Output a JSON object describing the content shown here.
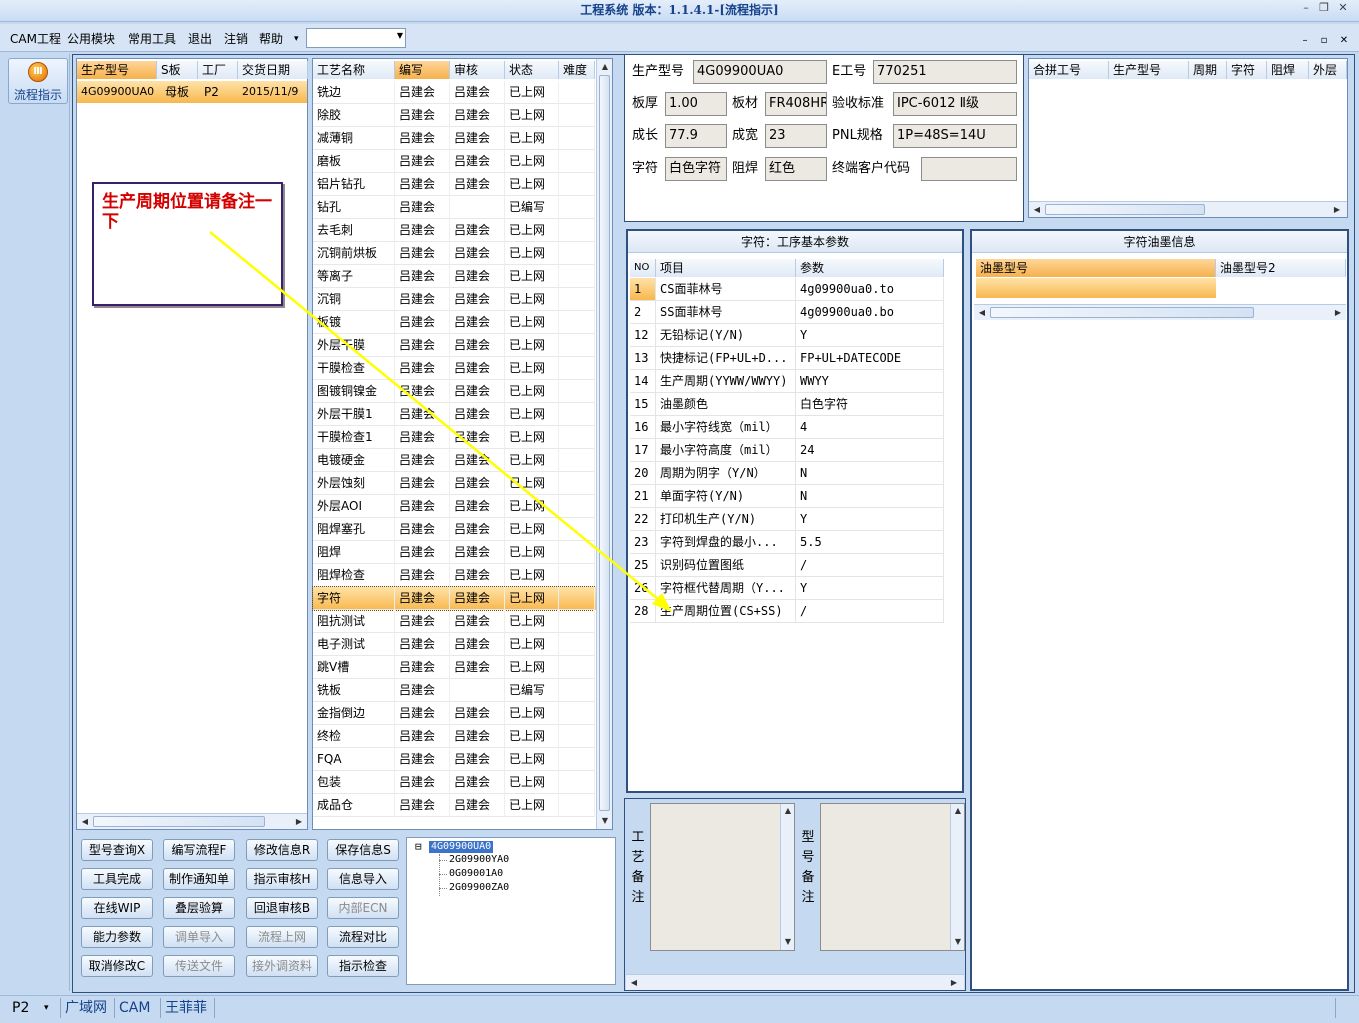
{
  "window": {
    "title": "工程系统 版本：1.1.4.1-[流程指示]",
    "min": "–",
    "max": "❐",
    "close": "✕"
  },
  "menu": {
    "items": [
      "CAM工程",
      "公用模块",
      "常用工具",
      "退出",
      "注销",
      "帮助"
    ],
    "help_arrow": "▾",
    "combo_value": "",
    "mdi": [
      "–",
      "▫",
      "✕"
    ]
  },
  "sidebar": {
    "button_label": "流程指示",
    "icon": "flow-icon"
  },
  "order_table": {
    "headers": [
      "生产型号",
      "S板",
      "工厂",
      "交货日期"
    ],
    "rows": [
      [
        "4G09900UA0",
        "母板",
        "P2",
        "2015/11/9"
      ]
    ]
  },
  "process_table": {
    "headers": [
      "工艺名称",
      "编写",
      "审核",
      "状态",
      "难度"
    ],
    "rows": [
      [
        "铣边",
        "吕建会",
        "吕建会",
        "已上网",
        ""
      ],
      [
        "除胶",
        "吕建会",
        "吕建会",
        "已上网",
        ""
      ],
      [
        "减薄铜",
        "吕建会",
        "吕建会",
        "已上网",
        ""
      ],
      [
        "磨板",
        "吕建会",
        "吕建会",
        "已上网",
        ""
      ],
      [
        "铝片钻孔",
        "吕建会",
        "吕建会",
        "已上网",
        ""
      ],
      [
        "钻孔",
        "吕建会",
        "",
        "已编写",
        ""
      ],
      [
        "去毛刺",
        "吕建会",
        "吕建会",
        "已上网",
        ""
      ],
      [
        "沉铜前烘板",
        "吕建会",
        "吕建会",
        "已上网",
        ""
      ],
      [
        "等离子",
        "吕建会",
        "吕建会",
        "已上网",
        ""
      ],
      [
        "沉铜",
        "吕建会",
        "吕建会",
        "已上网",
        ""
      ],
      [
        "板镀",
        "吕建会",
        "吕建会",
        "已上网",
        ""
      ],
      [
        "外层干膜",
        "吕建会",
        "吕建会",
        "已上网",
        ""
      ],
      [
        "干膜检查",
        "吕建会",
        "吕建会",
        "已上网",
        ""
      ],
      [
        "图镀铜镍金",
        "吕建会",
        "吕建会",
        "已上网",
        ""
      ],
      [
        "外层干膜1",
        "吕建会",
        "吕建会",
        "已上网",
        ""
      ],
      [
        "干膜检查1",
        "吕建会",
        "吕建会",
        "已上网",
        ""
      ],
      [
        "电镀硬金",
        "吕建会",
        "吕建会",
        "已上网",
        ""
      ],
      [
        "外层蚀刻",
        "吕建会",
        "吕建会",
        "已上网",
        ""
      ],
      [
        "外层AOI",
        "吕建会",
        "吕建会",
        "已上网",
        ""
      ],
      [
        "阻焊塞孔",
        "吕建会",
        "吕建会",
        "已上网",
        ""
      ],
      [
        "阻焊",
        "吕建会",
        "吕建会",
        "已上网",
        ""
      ],
      [
        "阻焊检查",
        "吕建会",
        "吕建会",
        "已上网",
        ""
      ],
      [
        "字符",
        "吕建会",
        "吕建会",
        "已上网",
        ""
      ],
      [
        "阻抗测试",
        "吕建会",
        "吕建会",
        "已上网",
        ""
      ],
      [
        "电子测试",
        "吕建会",
        "吕建会",
        "已上网",
        ""
      ],
      [
        "跳V槽",
        "吕建会",
        "吕建会",
        "已上网",
        ""
      ],
      [
        "铣板",
        "吕建会",
        "",
        "已编写",
        ""
      ],
      [
        "金指倒边",
        "吕建会",
        "吕建会",
        "已上网",
        ""
      ],
      [
        "终检",
        "吕建会",
        "吕建会",
        "已上网",
        ""
      ],
      [
        "FQA",
        "吕建会",
        "吕建会",
        "已上网",
        ""
      ],
      [
        "包装",
        "吕建会",
        "吕建会",
        "已上网",
        ""
      ],
      [
        "成品仓",
        "吕建会",
        "吕建会",
        "已上网",
        ""
      ]
    ],
    "selected_index": 22
  },
  "annotation": {
    "text": "生产周期位置请备注一下"
  },
  "buttons": {
    "rows": [
      [
        {
          "label": "型号查询X",
          "enabled": true
        },
        {
          "label": "编写流程F",
          "enabled": true
        },
        {
          "label": "修改信息R",
          "enabled": true
        },
        {
          "label": "保存信息S",
          "enabled": true
        }
      ],
      [
        {
          "label": "工具完成",
          "enabled": true
        },
        {
          "label": "制作通知单",
          "enabled": true
        },
        {
          "label": "指示审核H",
          "enabled": true
        },
        {
          "label": "信息导入",
          "enabled": true
        }
      ],
      [
        {
          "label": "在线WIP",
          "enabled": true
        },
        {
          "label": "叠层验算",
          "enabled": true
        },
        {
          "label": "回退审核B",
          "enabled": true
        },
        {
          "label": "内部ECN",
          "enabled": false
        }
      ],
      [
        {
          "label": "能力参数",
          "enabled": true
        },
        {
          "label": "调单导入",
          "enabled": false
        },
        {
          "label": "流程上网",
          "enabled": false
        },
        {
          "label": "流程对比",
          "enabled": true
        }
      ],
      [
        {
          "label": "取消修改C",
          "enabled": true
        },
        {
          "label": "传送文件",
          "enabled": false
        },
        {
          "label": "接外调资料",
          "enabled": false
        },
        {
          "label": "指示检查",
          "enabled": true
        }
      ]
    ]
  },
  "tree": {
    "root": "4G09900UA0",
    "root_toggle": "⊟",
    "children": [
      "2G09900YA0",
      "0G09001A0",
      "2G09900ZA0"
    ]
  },
  "info": {
    "labels": {
      "model": "生产型号",
      "e_no": "E工号",
      "thickness": "板厚",
      "material": "板材",
      "standard": "验收标准",
      "length": "成长",
      "width": "成宽",
      "pnl": "PNL规格",
      "char": "字符",
      "mask": "阻焊",
      "customer": "终端客户代码"
    },
    "values": {
      "model": "4G09900UA0",
      "e_no": "770251",
      "thickness": "1.00",
      "material": "FR408HR",
      "standard": "IPC-6012 Ⅱ级",
      "length": "77.9",
      "width": "23",
      "pnl": "1P=48S=14U",
      "char": "白色字符",
      "mask": "红色",
      "customer": ""
    }
  },
  "merge_table": {
    "headers": [
      "合拼工号",
      "生产型号",
      "周期",
      "字符",
      "阻焊",
      "外层"
    ]
  },
  "params": {
    "title": "字符：工序基本参数",
    "headers": [
      "NO",
      "项目",
      "参数"
    ],
    "rows": [
      [
        "1",
        "CS面菲林号",
        "4g09900ua0.to"
      ],
      [
        "2",
        "SS面菲林号",
        "4g09900ua0.bo"
      ],
      [
        "12",
        "无铅标记(Y/N)",
        "Y"
      ],
      [
        "13",
        "快捷标记(FP+UL+D...",
        "FP+UL+DATECODE"
      ],
      [
        "14",
        "生产周期(YYWW/WWYY)",
        "WWYY"
      ],
      [
        "15",
        "油墨颜色",
        "白色字符"
      ],
      [
        "16",
        "最小字符线宽（mil）",
        "4"
      ],
      [
        "17",
        "最小字符高度（mil）",
        "24"
      ],
      [
        "20",
        "周期为阴字（Y/N）",
        "N"
      ],
      [
        "21",
        "单面字符(Y/N)",
        "N"
      ],
      [
        "22",
        "打印机生产(Y/N)",
        "Y"
      ],
      [
        "23",
        "字符到焊盘的最小...",
        "5.5"
      ],
      [
        "25",
        "识别码位置图纸",
        "/"
      ],
      [
        "26",
        "字符框代替周期（Y...",
        "Y"
      ],
      [
        "28",
        "生产周期位置(CS+SS)",
        "/"
      ]
    ],
    "selected_index": 0
  },
  "ink": {
    "title": "字符油墨信息",
    "headers": [
      "油墨型号",
      "油墨型号2"
    ]
  },
  "remarks": {
    "process_label": "工艺备注",
    "model_label": "型号备注",
    "process_text": "",
    "model_text": ""
  },
  "statusbar": {
    "items": [
      "P2",
      "广域网",
      "CAM",
      "王菲菲"
    ],
    "dropdown": "▾"
  },
  "colors": {
    "accent": "#f5b14c",
    "annotation_text": "#d40000",
    "arrow": "#ffff00",
    "frame": "#c5daf0"
  }
}
